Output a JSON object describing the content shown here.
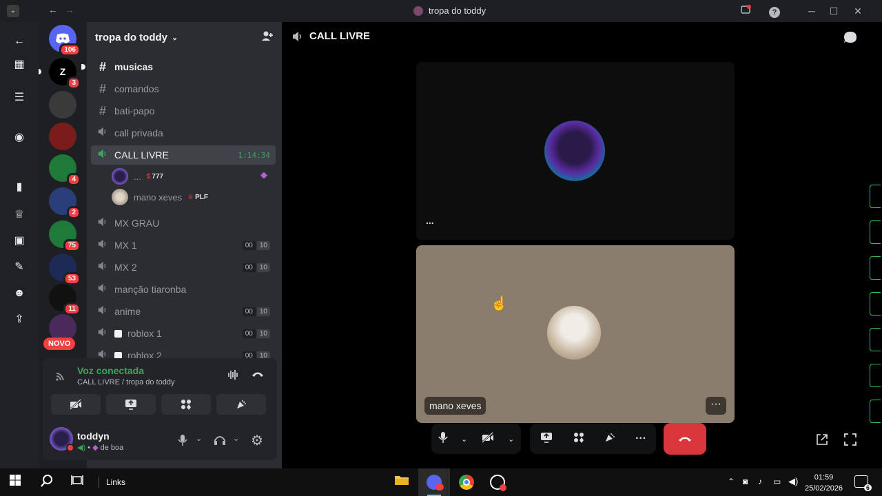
{
  "window": {
    "title": "tropa do toddy",
    "help_icon": "?"
  },
  "server_list": {
    "home_badge": "106",
    "servers": [
      {
        "label": "Z",
        "badge": "3",
        "color": "#000000"
      },
      {
        "label": "",
        "badge": "",
        "color": "#3a3a3a"
      },
      {
        "label": "",
        "badge": "",
        "color": "#7a1c1c"
      },
      {
        "label": "",
        "badge": "4",
        "color": "#1f7a3a"
      },
      {
        "label": "",
        "badge": "2",
        "color": "#2a3f7a"
      },
      {
        "label": "",
        "badge": "75",
        "color": "#1f7a3a"
      },
      {
        "label": "",
        "badge": "53",
        "color": "#1d2a55"
      },
      {
        "label": "",
        "badge": "11",
        "color": "#111111"
      },
      {
        "label": "",
        "badge": "",
        "color": "#4a2a5a"
      }
    ],
    "novo_label": "NOVO"
  },
  "sidebar": {
    "server_name": "tropa do toddy",
    "channels": [
      {
        "name": "musicas",
        "type": "text",
        "unread": true
      },
      {
        "name": "comandos",
        "type": "text"
      },
      {
        "name": "bati-papo",
        "type": "text"
      },
      {
        "name": "call privada",
        "type": "voice"
      },
      {
        "name": "CALL LIVRE",
        "type": "voice",
        "active": true,
        "timer": "1:14:34"
      },
      {
        "name": "MX GRAU",
        "type": "voice"
      },
      {
        "name": "MX 1",
        "type": "voice",
        "pill_a": "00",
        "pill_b": "10"
      },
      {
        "name": "MX 2",
        "type": "voice",
        "pill_a": "00",
        "pill_b": "10"
      },
      {
        "name": "manção tiaronba",
        "type": "voice"
      },
      {
        "name": "anime",
        "type": "voice",
        "pill_a": "00",
        "pill_b": "10"
      },
      {
        "name": "roblox 1",
        "type": "voice",
        "pill_a": "00",
        "pill_b": "10"
      },
      {
        "name": "roblox 2",
        "type": "voice",
        "pill_a": "00",
        "pill_b": "10"
      }
    ],
    "voice_users": [
      {
        "name": "...",
        "tag": "777"
      },
      {
        "name": "mano xeves",
        "tag": "PLF"
      }
    ]
  },
  "voice_panel": {
    "status": "Voz conectada",
    "location": "CALL LIVRE / tropa do toddy"
  },
  "user_panel": {
    "username": "toddyn",
    "status": "de boa"
  },
  "main": {
    "channel_title": "CALL LIVRE",
    "tile_more": "...",
    "tile2_name": "mano xeves",
    "tile2_more": "···"
  },
  "taskbar": {
    "links_label": "Links",
    "time": "01:59",
    "date": "25/02/2026",
    "notif_count": "6"
  },
  "colors": {
    "active_green": "#3ba55c",
    "hangup_red": "#da373c",
    "badge_red": "#f23f43"
  }
}
